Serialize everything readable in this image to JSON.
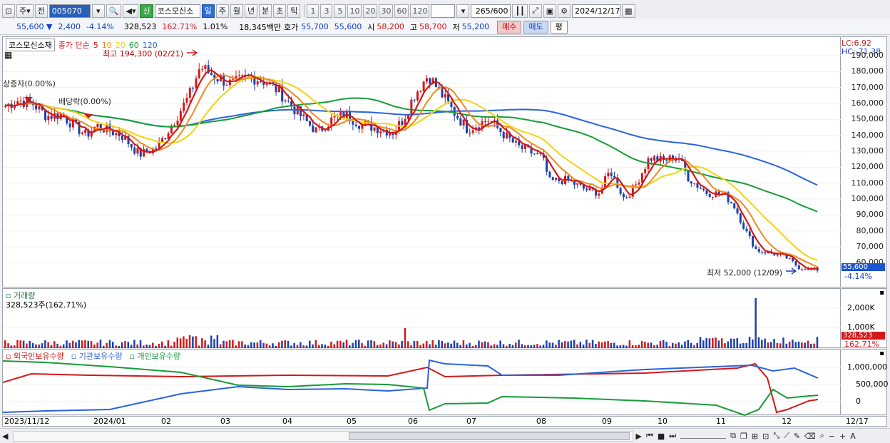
{
  "toolbar": {
    "period_sel": "주",
    "prev_label": "전",
    "code": "005070",
    "new_label": "신",
    "stock_name": "코스모신소",
    "periods": [
      "일",
      "주",
      "월",
      "년",
      "분",
      "초",
      "틱"
    ],
    "active_period": "일",
    "nums": [
      "1",
      "3",
      "5",
      "10",
      "20",
      "30",
      "60",
      "120"
    ],
    "count": "265",
    "count_total": "/600",
    "date": "2024/12/17"
  },
  "quote": {
    "price": "55,600",
    "arrow": "▼",
    "change": "2,400",
    "change_pct": "-4.14%",
    "volume": "328,523",
    "vol_ratio": "162.71%",
    "turnover": "1.01%",
    "amount": "18,345백만",
    "hoga_label": "호가",
    "ask": "55,700",
    "bid": "55,600",
    "open_label": "시",
    "open": "58,200",
    "high_label": "고",
    "high": "58,700",
    "low_label": "저",
    "low": "55,200",
    "buy_label": "매수",
    "sell_label": "매도",
    "eval_label": "평"
  },
  "price_panel": {
    "title": "코스모신소재",
    "legend_prefix": "종가 단순",
    "ma": [
      {
        "label": "5",
        "color": "#d41818"
      },
      {
        "label": "10",
        "color": "#f08a1c"
      },
      {
        "label": "20",
        "color": "#f2d40a"
      },
      {
        "label": "60",
        "color": "#169c38"
      },
      {
        "label": "120",
        "color": "#2a63e0"
      }
    ],
    "high_note": "최고 194,300 (02/21)",
    "low_note": "최저 52,000 (12/09)",
    "limit_up": "상증자(0.00%)",
    "dividend": "배당락(0.00%)",
    "lc": "LC:6.92",
    "hc": "HC:-71.38",
    "y_labels": [
      "190,000",
      "180,000",
      "170,000",
      "160,000",
      "150,000",
      "140,000",
      "130,000",
      "120,000",
      "110,000",
      "100,000",
      "90,000",
      "80,000",
      "70,000",
      "60,000"
    ],
    "current_tag": "55,600",
    "current_pct": "-4.14%"
  },
  "volume_panel": {
    "title": "거래량",
    "value": "328,523주(162.71%)",
    "y_labels": [
      "2,000K",
      "1,000K"
    ],
    "tag": "328,523",
    "tag_pct": "162.71%"
  },
  "hold_panel": {
    "foreign": "외국인보유수량",
    "inst": "기관보유수량",
    "indiv": "개인보유수량",
    "y_labels": [
      "1,000,000",
      "500,000",
      "0"
    ]
  },
  "x_labels": [
    "2023/11/12",
    "2024/01",
    "02",
    "03",
    "04",
    "05",
    "06",
    "07",
    "08",
    "09",
    "10",
    "11",
    "12"
  ],
  "x_right": "12/17",
  "chart_data": {
    "type": "line",
    "title": "코스모신소재",
    "ylim": [
      50000,
      195000
    ],
    "x": [
      "2023/11",
      "2023/12",
      "2024/01",
      "2024/02",
      "2024/03",
      "2024/04",
      "2024/05",
      "2024/06",
      "2024/07",
      "2024/08",
      "2024/09",
      "2024/10",
      "2024/11",
      "2024/12"
    ],
    "series": [
      {
        "name": "5",
        "values": [
          162000,
          152000,
          140000,
          185000,
          172000,
          145000,
          148000,
          170000,
          145000,
          110000,
          108000,
          125000,
          100000,
          56000
        ]
      },
      {
        "name": "120",
        "values": [
          170000,
          162000,
          155000,
          150000,
          157000,
          157000,
          156000,
          155000,
          155000,
          150000,
          140000,
          130000,
          120000,
          106000
        ]
      },
      {
        "name": "60",
        "values": [
          155000,
          155000,
          150000,
          148000,
          150000,
          150000,
          160000,
          155000,
          150000,
          145000,
          125000,
          115000,
          105000,
          90000
        ]
      }
    ]
  },
  "colors": {
    "up": "#d41818",
    "down": "#1a3fae",
    "ma5": "#d41818",
    "ma10": "#f08a1c",
    "ma20": "#f2d40a",
    "ma60": "#169c38",
    "ma120": "#2a63e0"
  }
}
